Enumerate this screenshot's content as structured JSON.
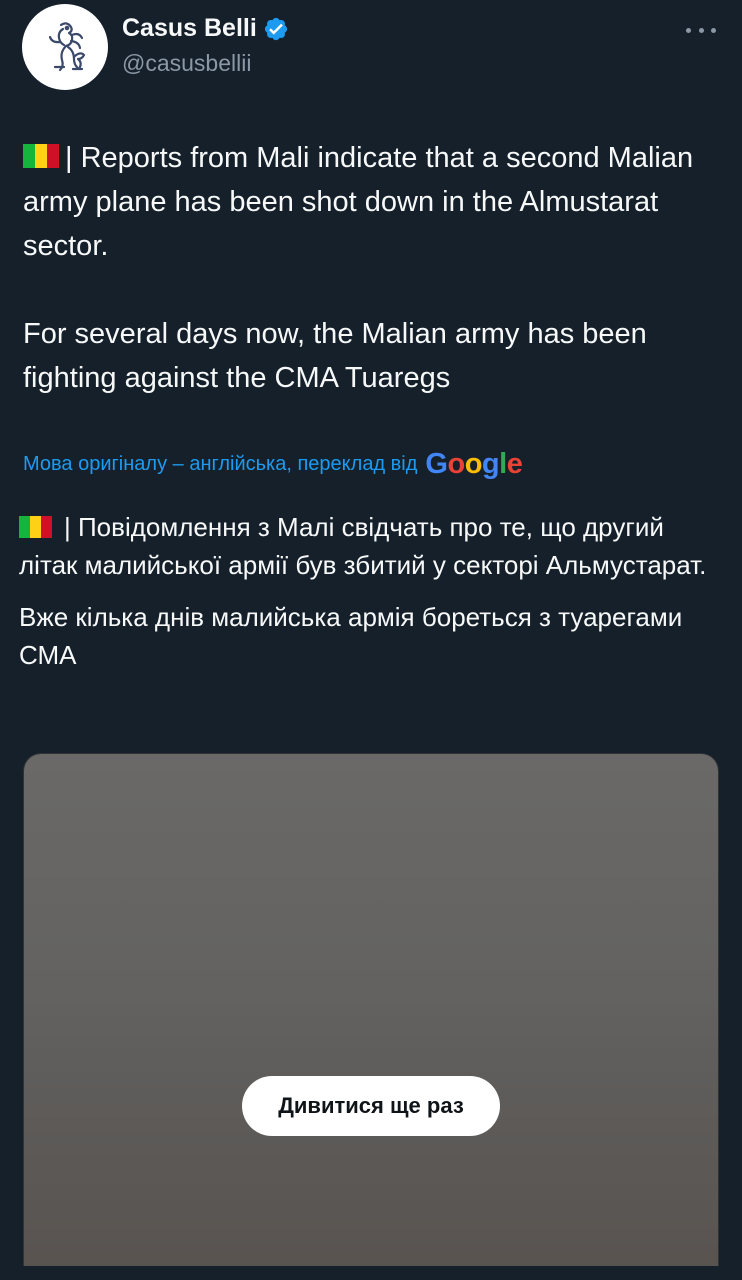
{
  "author": {
    "display_name": "Casus Belli",
    "handle": "@casusbellii",
    "avatar_icon": "lion-rampant-logo",
    "verified_icon": "verified-badge-icon",
    "verified_color": "#1d9bf0"
  },
  "menu": {
    "icon": "more-horizontal-icon"
  },
  "tweet": {
    "flag_icon": "mali-flag-emoji",
    "paragraph1": "| Reports from Mali indicate that a second Malian army plane has been shot down in the Almustarat sector.",
    "paragraph2": "For several days now, the Malian army has been fighting against the CMA Tuaregs"
  },
  "translation": {
    "meta_text": "Мова оригіналу – англійська, переклад від",
    "provider": "Google",
    "paragraph1": "| Повідомлення з Малі свідчать про те, що другий літак малийської армії був збитий у секторі Альмустарат.",
    "paragraph2": "Вже кілька днів малийська армія бореться з туарегами СМА"
  },
  "media": {
    "replay_label": "Дивитися ще раз"
  },
  "colors": {
    "background": "#15202b",
    "text": "#f7f9f9",
    "secondary_text": "#8b98a5",
    "link": "#1d9bf0"
  }
}
